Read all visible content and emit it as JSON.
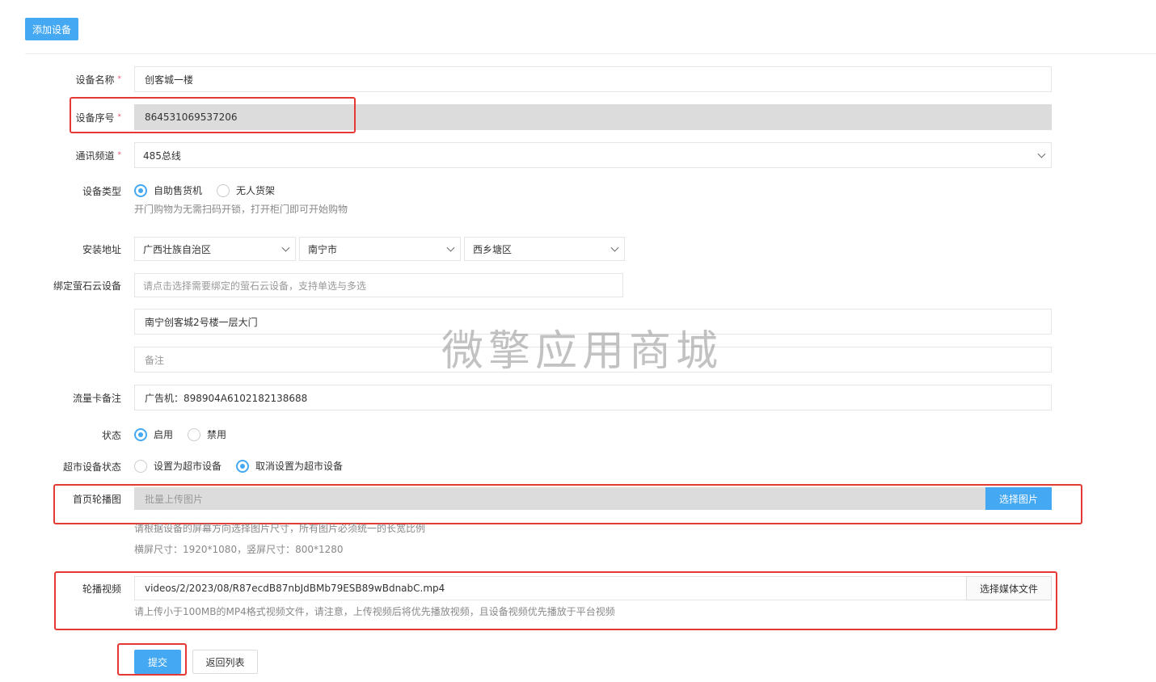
{
  "toolbar": {
    "add_device_label": "添加设备"
  },
  "form": {
    "device_name": {
      "label": "设备名称",
      "required": "*",
      "value": "创客城一楼"
    },
    "device_serial": {
      "label": "设备序号",
      "required": "*",
      "value": "864531069537206"
    },
    "channel": {
      "label": "通讯频道",
      "required": "*",
      "value": "485总线"
    },
    "device_type": {
      "label": "设备类型",
      "options": [
        "自助售货机",
        "无人货架"
      ],
      "selected": "自助售货机",
      "hint": "开门购物为无需扫码开锁，打开柜门即可开始购物"
    },
    "address": {
      "label": "安装地址",
      "province": "广西壮族自治区",
      "city": "南宁市",
      "district": "西乡塘区"
    },
    "bind_ezviz": {
      "label": "绑定萤石云设备",
      "placeholder": "请点击选择需要绑定的萤石云设备，支持单选与多选"
    },
    "detail_address": {
      "value": "南宁创客城2号楼一层大门"
    },
    "remark": {
      "placeholder": "备注"
    },
    "sim_note": {
      "label": "流量卡备注",
      "value": "广告机：898904A6102182138688"
    },
    "status": {
      "label": "状态",
      "options": [
        "启用",
        "禁用"
      ],
      "selected": "启用"
    },
    "market_status": {
      "label": "超市设备状态",
      "options": [
        "设置为超市设备",
        "取消设置为超市设备"
      ],
      "selected": "取消设置为超市设备"
    },
    "carousel": {
      "label": "首页轮播图",
      "placeholder": "批量上传图片",
      "button": "选择图片",
      "hint1": "请根据设备的屏幕方向选择图片尺寸，所有图片必须统一的长宽比例",
      "hint2": "横屏尺寸：1920*1080，竖屏尺寸：800*1280"
    },
    "video": {
      "label": "轮播视频",
      "value": "videos/2/2023/08/R87ecdB87nbJdBMb79ESB89wBdnabC.mp4",
      "button": "选择媒体文件",
      "hint": "请上传小于100MB的MP4格式视频文件，请注意，上传视频后将优先播放视频，且设备视频优先播放于平台视频"
    },
    "submit_label": "提交",
    "back_label": "返回列表"
  },
  "watermark": "微擎应用商城",
  "colors": {
    "primary": "#44a8f2",
    "annotation_red": "#e53935",
    "required": "#f0506e"
  }
}
